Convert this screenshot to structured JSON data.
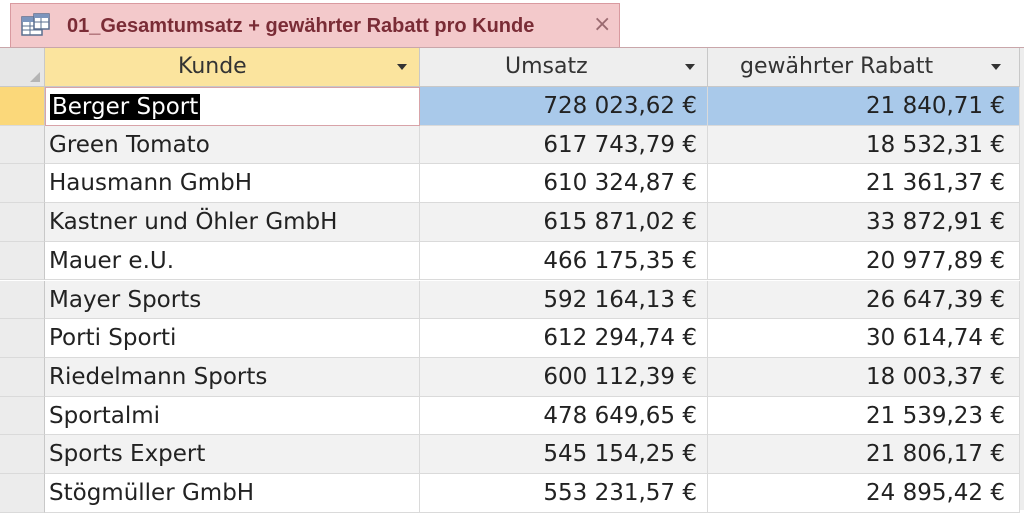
{
  "tab": {
    "title": "01_Gesamtumsatz + gewährter Rabatt pro Kunde",
    "close_glyph": "×",
    "icon": "query-datasheet-icon"
  },
  "columns": [
    "Kunde",
    "Umsatz",
    "gewährter Rabatt"
  ],
  "rows": [
    {
      "kunde": "Berger Sport",
      "umsatz": "728 023,62 €",
      "rabatt": "21 840,71 €"
    },
    {
      "kunde": "Green Tomato",
      "umsatz": "617 743,79 €",
      "rabatt": "18 532,31 €"
    },
    {
      "kunde": "Hausmann GmbH",
      "umsatz": "610 324,87 €",
      "rabatt": "21 361,37 €"
    },
    {
      "kunde": "Kastner und Öhler GmbH",
      "umsatz": "615 871,02 €",
      "rabatt": "33 872,91 €"
    },
    {
      "kunde": "Mauer e.U.",
      "umsatz": "466 175,35 €",
      "rabatt": "20 977,89 €"
    },
    {
      "kunde": "Mayer Sports",
      "umsatz": "592 164,13 €",
      "rabatt": "26 647,39 €"
    },
    {
      "kunde": "Porti Sporti",
      "umsatz": "612 294,74 €",
      "rabatt": "30 614,74 €"
    },
    {
      "kunde": "Riedelmann Sports",
      "umsatz": "600 112,39 €",
      "rabatt": "18 003,37 €"
    },
    {
      "kunde": "Sportalmi",
      "umsatz": "478 649,65 €",
      "rabatt": "21 539,23 €"
    },
    {
      "kunde": "Sports Expert",
      "umsatz": "545 154,25 €",
      "rabatt": "21 806,17 €"
    },
    {
      "kunde": "Stögmüller GmbH",
      "umsatz": "553 231,57 €",
      "rabatt": "24 895,42 €"
    }
  ],
  "colors": {
    "tab_bg": "#f3c9cb",
    "header_sorted_bg": "#fbe49e",
    "selected_row_bg": "#a9c9ea",
    "selected_record_marker": "#fbd87a"
  }
}
